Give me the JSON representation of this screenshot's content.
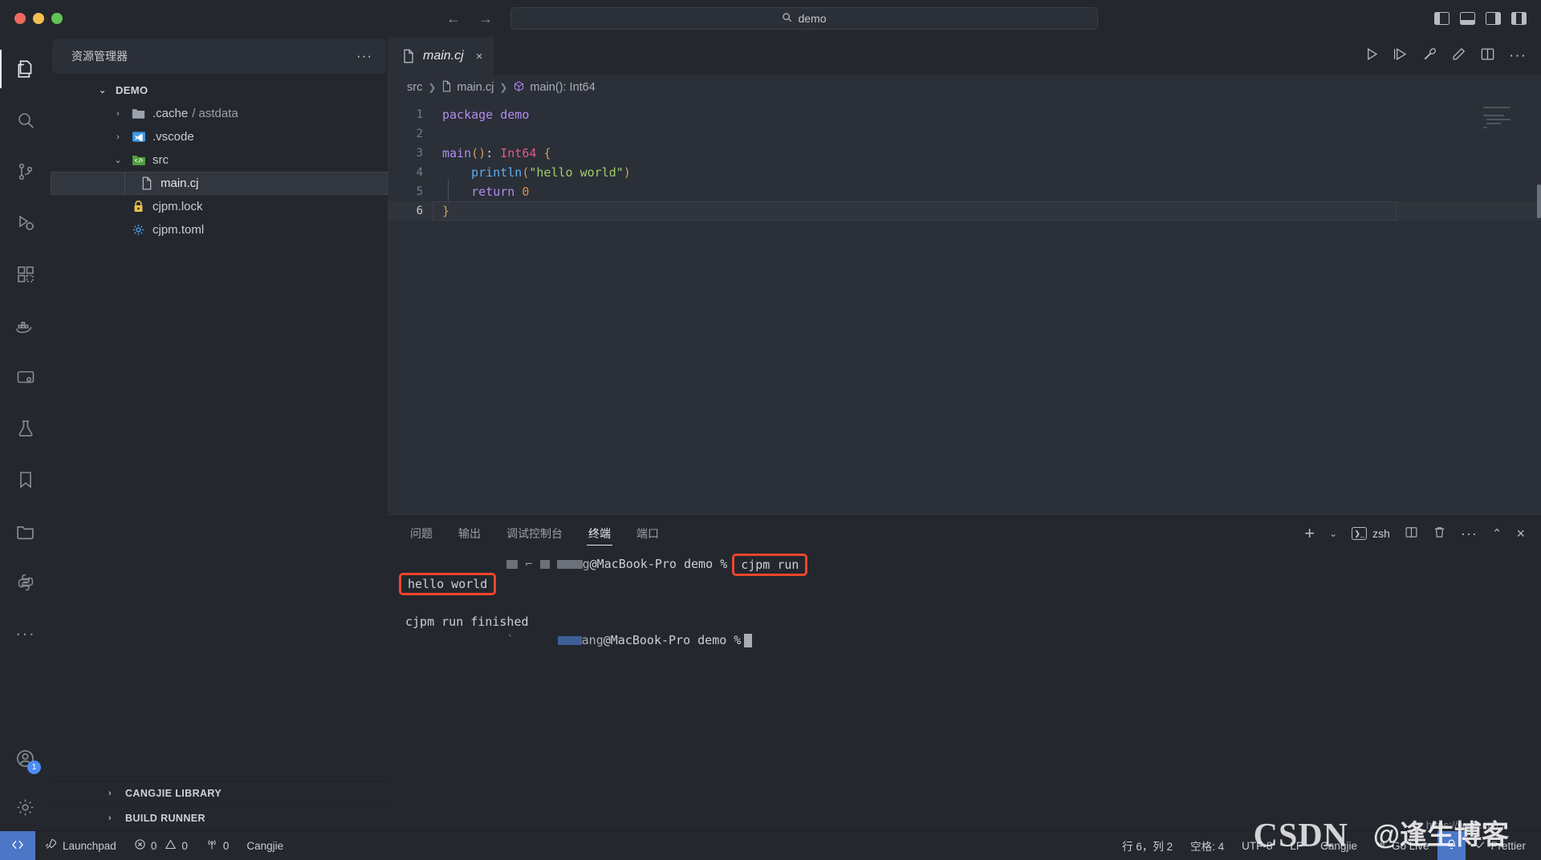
{
  "titlebar": {
    "search_value": "demo",
    "search_icon": "magnifier-icon",
    "back_icon": "←",
    "forward_icon": "→"
  },
  "activitybar": {
    "items": [
      {
        "name": "explorer",
        "icon": "files-icon"
      },
      {
        "name": "search",
        "icon": "search-icon"
      },
      {
        "name": "source-control",
        "icon": "source-control-icon"
      },
      {
        "name": "run-and-debug",
        "icon": "run-debug-icon"
      },
      {
        "name": "extensions",
        "icon": "extensions-icon"
      },
      {
        "name": "docker",
        "icon": "docker-icon"
      },
      {
        "name": "remote-explorer",
        "icon": "remote-icon"
      },
      {
        "name": "testing",
        "icon": "beaker-icon"
      },
      {
        "name": "bookmarks",
        "icon": "bookmark-icon"
      },
      {
        "name": "file-browser",
        "icon": "folder-icon"
      },
      {
        "name": "python",
        "icon": "python-icon"
      },
      {
        "name": "more",
        "icon": "ellipsis-icon"
      }
    ],
    "account_badge": "1",
    "account_icon": "account-icon",
    "settings_icon": "gear-icon"
  },
  "sidebar": {
    "title": "资源管理器",
    "more_icon": "ellipsis-icon",
    "root": "DEMO",
    "tree": [
      {
        "label": ".cache / astdata",
        "label_main": ".cache",
        "label_dim": "/ astdata",
        "icon": "folder-icon",
        "twisty": "›",
        "depth": 1,
        "selected": false
      },
      {
        "label": ".vscode",
        "icon": "vscode-folder-icon",
        "twisty": "›",
        "depth": 1,
        "selected": false
      },
      {
        "label": "src",
        "icon": "src-folder-icon",
        "twisty": "⌄",
        "depth": 1,
        "selected": false
      },
      {
        "label": "main.cj",
        "icon": "file-icon",
        "twisty": "",
        "depth": 2,
        "selected": true
      },
      {
        "label": "cjpm.lock",
        "icon": "lock-icon",
        "twisty": "",
        "depth": 1,
        "selected": false
      },
      {
        "label": "cjpm.toml",
        "icon": "gear-icon",
        "twisty": "",
        "depth": 1,
        "selected": false
      }
    ],
    "bottom_sections": [
      {
        "label": "CANGJIE LIBRARY",
        "twisty": "›"
      },
      {
        "label": "BUILD RUNNER",
        "twisty": "›"
      }
    ]
  },
  "editor": {
    "tab": {
      "label": "main.cj",
      "file_icon": "file-icon",
      "close_icon": "×"
    },
    "tab_actions": [
      "run-icon",
      "run-debug-icon",
      "wrench-icon",
      "pencil-icon",
      "split-editor-icon",
      "ellipsis-icon"
    ],
    "breadcrumb": [
      {
        "label": "src",
        "icon": ""
      },
      {
        "label": "main.cj",
        "icon": "file-icon"
      },
      {
        "label": "main(): Int64",
        "icon": "symbol-method-icon"
      }
    ],
    "lines": [
      {
        "n": "1",
        "tokens": [
          {
            "t": "package ",
            "c": "kw"
          },
          {
            "t": "demo",
            "c": "kw"
          }
        ]
      },
      {
        "n": "2",
        "tokens": []
      },
      {
        "n": "3",
        "tokens": [
          {
            "t": "main",
            "c": "fn"
          },
          {
            "t": "()",
            "c": "paren"
          },
          {
            "t": ": ",
            "c": "plain"
          },
          {
            "t": "Int64",
            "c": "type"
          },
          {
            "t": " ",
            "c": "plain"
          },
          {
            "t": "{",
            "c": "brace"
          }
        ]
      },
      {
        "n": "4",
        "tokens": [
          {
            "t": "    ",
            "c": "plain"
          },
          {
            "t": "println",
            "c": "call"
          },
          {
            "t": "(",
            "c": "paren"
          },
          {
            "t": "\"hello world\"",
            "c": "str"
          },
          {
            "t": ")",
            "c": "paren"
          }
        ]
      },
      {
        "n": "5",
        "tokens": [
          {
            "t": "    ",
            "c": "plain"
          },
          {
            "t": "return",
            "c": "kw"
          },
          {
            "t": " ",
            "c": "plain"
          },
          {
            "t": "0",
            "c": "num"
          }
        ]
      },
      {
        "n": "6",
        "tokens": [
          {
            "t": "}",
            "c": "brace"
          }
        ]
      }
    ],
    "current_line": 6
  },
  "panel": {
    "tabs": [
      {
        "label": "问题",
        "active": false
      },
      {
        "label": "输出",
        "active": false
      },
      {
        "label": "调试控制台",
        "active": false
      },
      {
        "label": "终端",
        "active": true
      },
      {
        "label": "端口",
        "active": false
      }
    ],
    "actions": {
      "new_terminal_icon": "plus-icon",
      "dropdown_icon": "chevron-down-icon",
      "shell_name": "zsh",
      "shell_icon": "terminal-icon",
      "split_icon": "split-icon",
      "kill_icon": "trash-icon",
      "more_icon": "ellipsis-icon",
      "maximize_icon": "chevron-up-icon",
      "close_icon": "×"
    },
    "terminal_lines": [
      {
        "type": "prompt",
        "user_masked": true,
        "host": "@MacBook-Pro demo %",
        "command": "cjpm run",
        "command_highlighted": true
      },
      {
        "type": "output",
        "text": "hello world",
        "highlighted": true
      },
      {
        "type": "blank",
        "text": ""
      },
      {
        "type": "output",
        "text": "cjpm run finished",
        "highlighted": false
      },
      {
        "type": "prompt2",
        "user_masked": true,
        "host": "@MacBook-Pro demo %",
        "cursor": true
      }
    ],
    "highlight_color": "#f0462d"
  },
  "statusbar": {
    "remote_icon": "remote-indicator-icon",
    "left_items": [
      {
        "name": "launchpad",
        "icon": "rocket-icon",
        "label": "Launchpad"
      },
      {
        "name": "problems",
        "icon": "error-warning-icon",
        "label": "0 ⚠ 0",
        "errors": "0",
        "warnings": "0"
      },
      {
        "name": "radio-tower",
        "icon": "radio-tower-icon",
        "label": "0"
      },
      {
        "name": "language-mode-left",
        "icon": "",
        "label": "Cangjie"
      }
    ],
    "right_items": [
      {
        "name": "cursor-position",
        "label": "行 6，列 2"
      },
      {
        "name": "indentation",
        "label": "空格: 4"
      },
      {
        "name": "encoding",
        "label": "UTF-8"
      },
      {
        "name": "eol",
        "label": "LF"
      },
      {
        "name": "language-mode",
        "label": "Cangjie"
      },
      {
        "name": "go-live",
        "icon": "broadcast-icon",
        "label": "Go Live"
      },
      {
        "name": "prettier",
        "icon": "check-icon",
        "label": "Prettier"
      }
    ],
    "bell_icon": "bell-icon"
  },
  "watermark": {
    "csdn": "CSDN",
    "author": "@逢生博客",
    "url": "https://www.cn.cn"
  }
}
